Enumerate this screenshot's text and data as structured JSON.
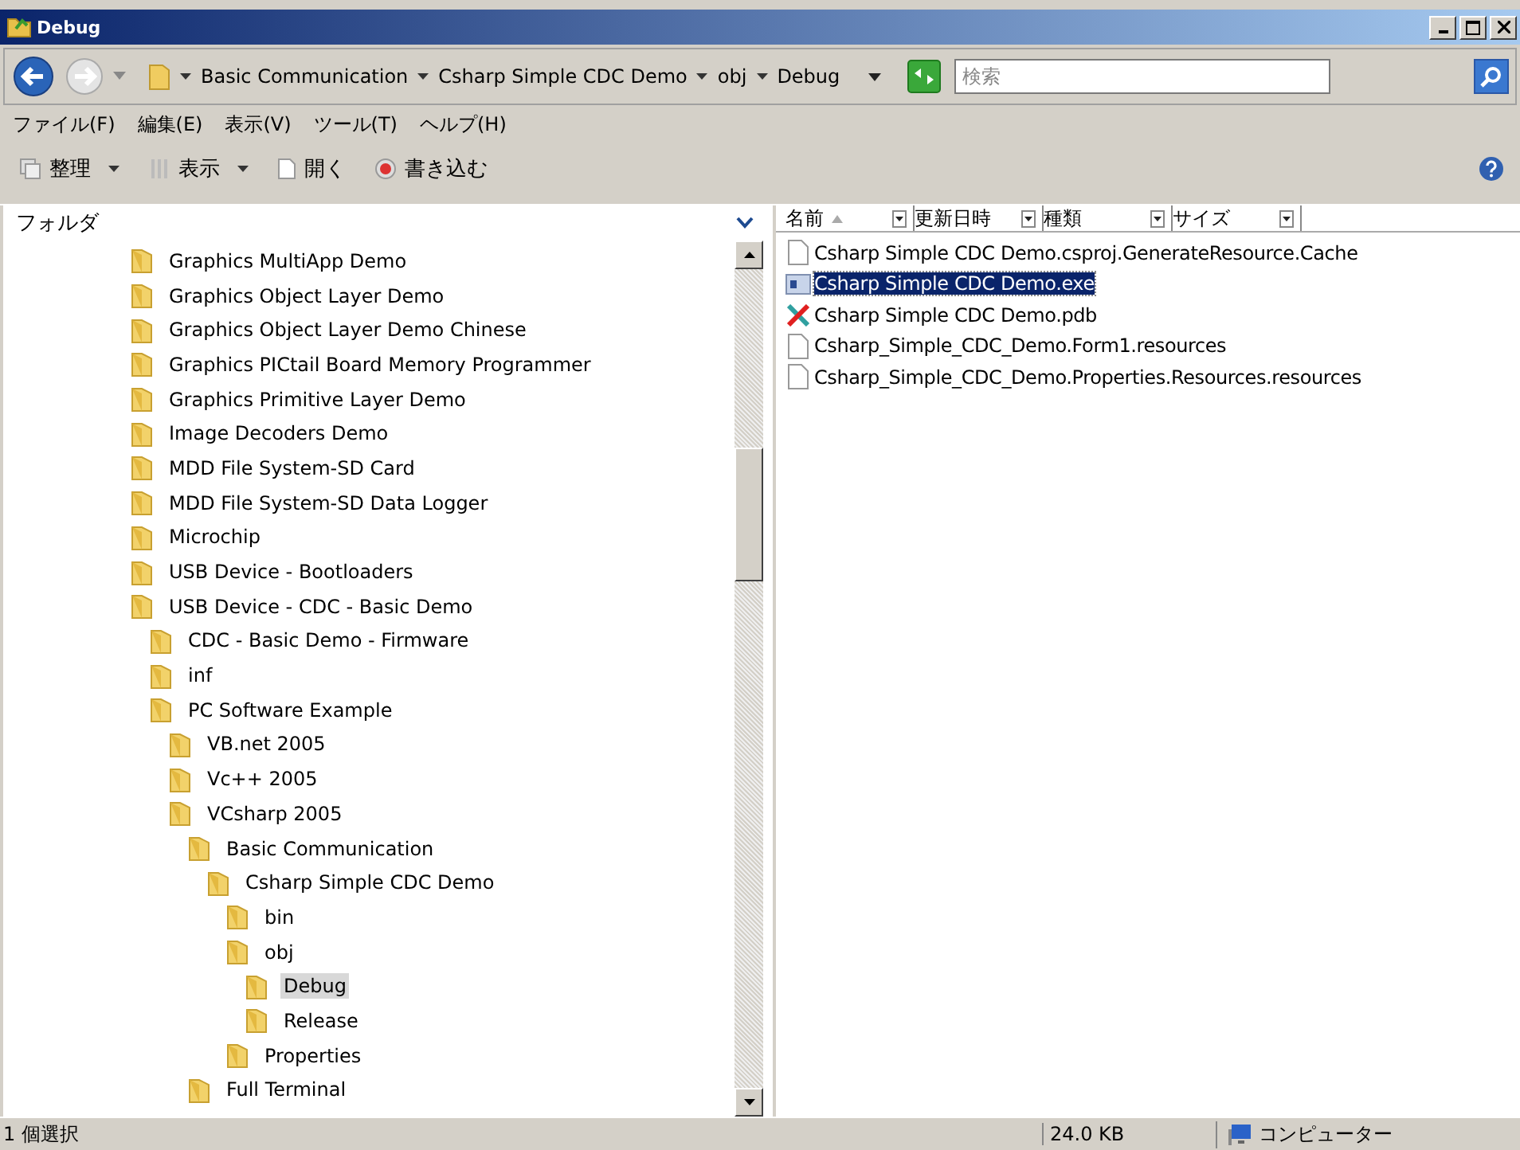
{
  "window": {
    "title": "Debug"
  },
  "address": {
    "crumbs": [
      "Basic Communication",
      "Csharp Simple CDC Demo",
      "obj",
      "Debug"
    ]
  },
  "search": {
    "placeholder": "検索"
  },
  "menu": [
    "ファイル(F)",
    "編集(E)",
    "表示(V)",
    "ツール(T)",
    "ヘルプ(H)"
  ],
  "toolbar": [
    {
      "label": "整理",
      "kind": "organize"
    },
    {
      "label": "表示",
      "kind": "views"
    },
    {
      "label": "開く",
      "kind": "open"
    },
    {
      "label": "書き込む",
      "kind": "burn"
    }
  ],
  "folders": {
    "title": "フォルダ",
    "items": [
      {
        "label": "Graphics MultiApp Demo",
        "selected": false
      },
      {
        "label": "Graphics Object Layer Demo",
        "selected": false
      },
      {
        "label": "Graphics Object Layer Demo Chinese",
        "selected": false
      },
      {
        "label": "Graphics PICtail Board Memory Programmer",
        "selected": false
      },
      {
        "label": "Graphics Primitive Layer Demo",
        "selected": false
      },
      {
        "label": "Image Decoders Demo",
        "selected": false
      },
      {
        "label": "MDD File System-SD Card",
        "selected": false
      },
      {
        "label": "MDD File System-SD Data Logger",
        "selected": false
      },
      {
        "label": "Microchip",
        "selected": false
      },
      {
        "label": "USB Device - Bootloaders",
        "selected": false
      },
      {
        "label": "USB Device - CDC - Basic Demo",
        "selected": false,
        "children": [
          {
            "label": "CDC - Basic Demo - Firmware",
            "selected": false
          },
          {
            "label": "inf",
            "selected": false
          },
          {
            "label": "PC Software Example",
            "selected": false,
            "children": [
              {
                "label": "VB.net 2005",
                "selected": false
              },
              {
                "label": "Vc++ 2005",
                "selected": false
              },
              {
                "label": "VCsharp 2005",
                "selected": false,
                "children": [
                  {
                    "label": "Basic Communication",
                    "selected": false,
                    "children": [
                      {
                        "label": "Csharp Simple CDC Demo",
                        "selected": false,
                        "children": [
                          {
                            "label": "bin",
                            "selected": false
                          },
                          {
                            "label": "obj",
                            "selected": false,
                            "children": [
                              {
                                "label": "Debug",
                                "selected": true
                              },
                              {
                                "label": "Release",
                                "selected": false
                              }
                            ]
                          },
                          {
                            "label": "Properties",
                            "selected": false
                          }
                        ]
                      }
                    ]
                  },
                  {
                    "label": "Full Terminal",
                    "selected": false
                  }
                ]
              }
            ]
          }
        ]
      }
    ]
  },
  "columns": [
    {
      "label": "名前",
      "sorted": true
    },
    {
      "label": "更新日時",
      "sorted": false
    },
    {
      "label": "種類",
      "sorted": false
    },
    {
      "label": "サイズ",
      "sorted": false
    }
  ],
  "files": [
    {
      "name": "Csharp Simple CDC Demo.csproj.GenerateResource.Cache",
      "kind": "file",
      "selected": false
    },
    {
      "name": "Csharp Simple CDC Demo.exe",
      "kind": "exe",
      "selected": true
    },
    {
      "name": "Csharp Simple CDC Demo.pdb",
      "kind": "pdb",
      "selected": false
    },
    {
      "name": "Csharp_Simple_CDC_Demo.Form1.resources",
      "kind": "file",
      "selected": false
    },
    {
      "name": "Csharp_Simple_CDC_Demo.Properties.Resources.resources",
      "kind": "file",
      "selected": false
    }
  ],
  "status_bar": {
    "selection": "1 個選択",
    "size": "24.0 KB",
    "location": "コンピューター"
  }
}
